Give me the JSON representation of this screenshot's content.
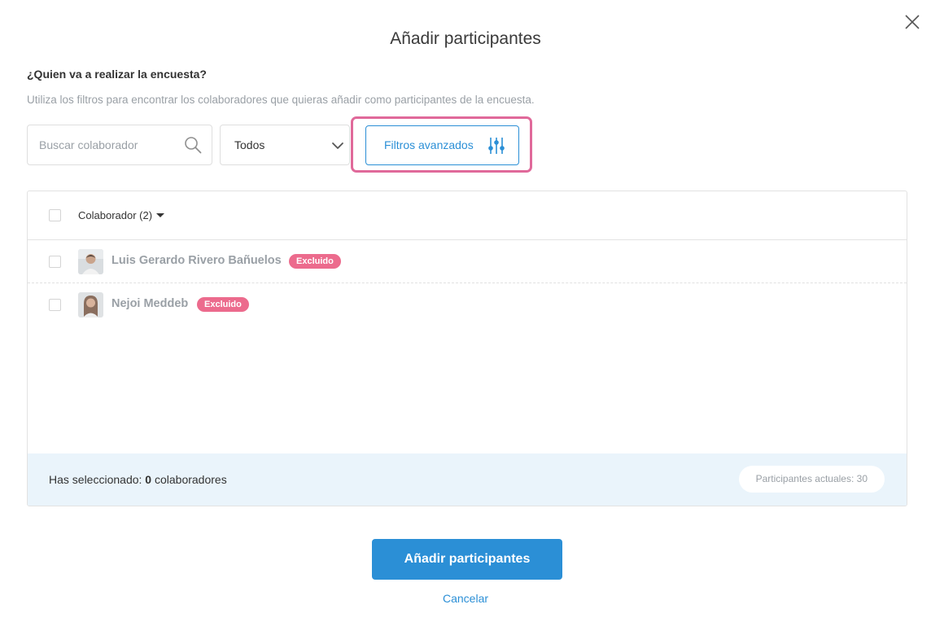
{
  "modal": {
    "title": "Añadir participantes",
    "close_icon": "close-icon"
  },
  "question": "¿Quien va a realizar la encuesta?",
  "helper_text": "Utiliza los filtros para encontrar los colaboradores que quieras añadir como participantes de la encuesta.",
  "search": {
    "placeholder": "Buscar colaborador",
    "value": "",
    "icon": "search-icon"
  },
  "filter_select": {
    "selected": "Todos",
    "icon": "chevron-down-icon"
  },
  "advanced_filters": {
    "label": "Filtros avanzados",
    "icon": "sliders-icon"
  },
  "table": {
    "column_header": "Colaborador (2)",
    "rows": [
      {
        "name": "Luis Gerardo Rivero Bañuelos",
        "badge": "Excluido",
        "checked": false
      },
      {
        "name": "Nejoi Meddeb",
        "badge": "Excluido",
        "checked": false
      }
    ]
  },
  "footer": {
    "selected_prefix": "Has seleccionado: ",
    "selected_count": "0",
    "selected_suffix": " colaboradores",
    "participants_pill": "Participantes actuales: 30"
  },
  "actions": {
    "primary": "Añadir participantes",
    "cancel": "Cancelar"
  },
  "colors": {
    "accent": "#2b8fd6",
    "highlight": "#e0699a",
    "badge": "#ec6b8d",
    "footer_bg": "#eaf4fb"
  }
}
